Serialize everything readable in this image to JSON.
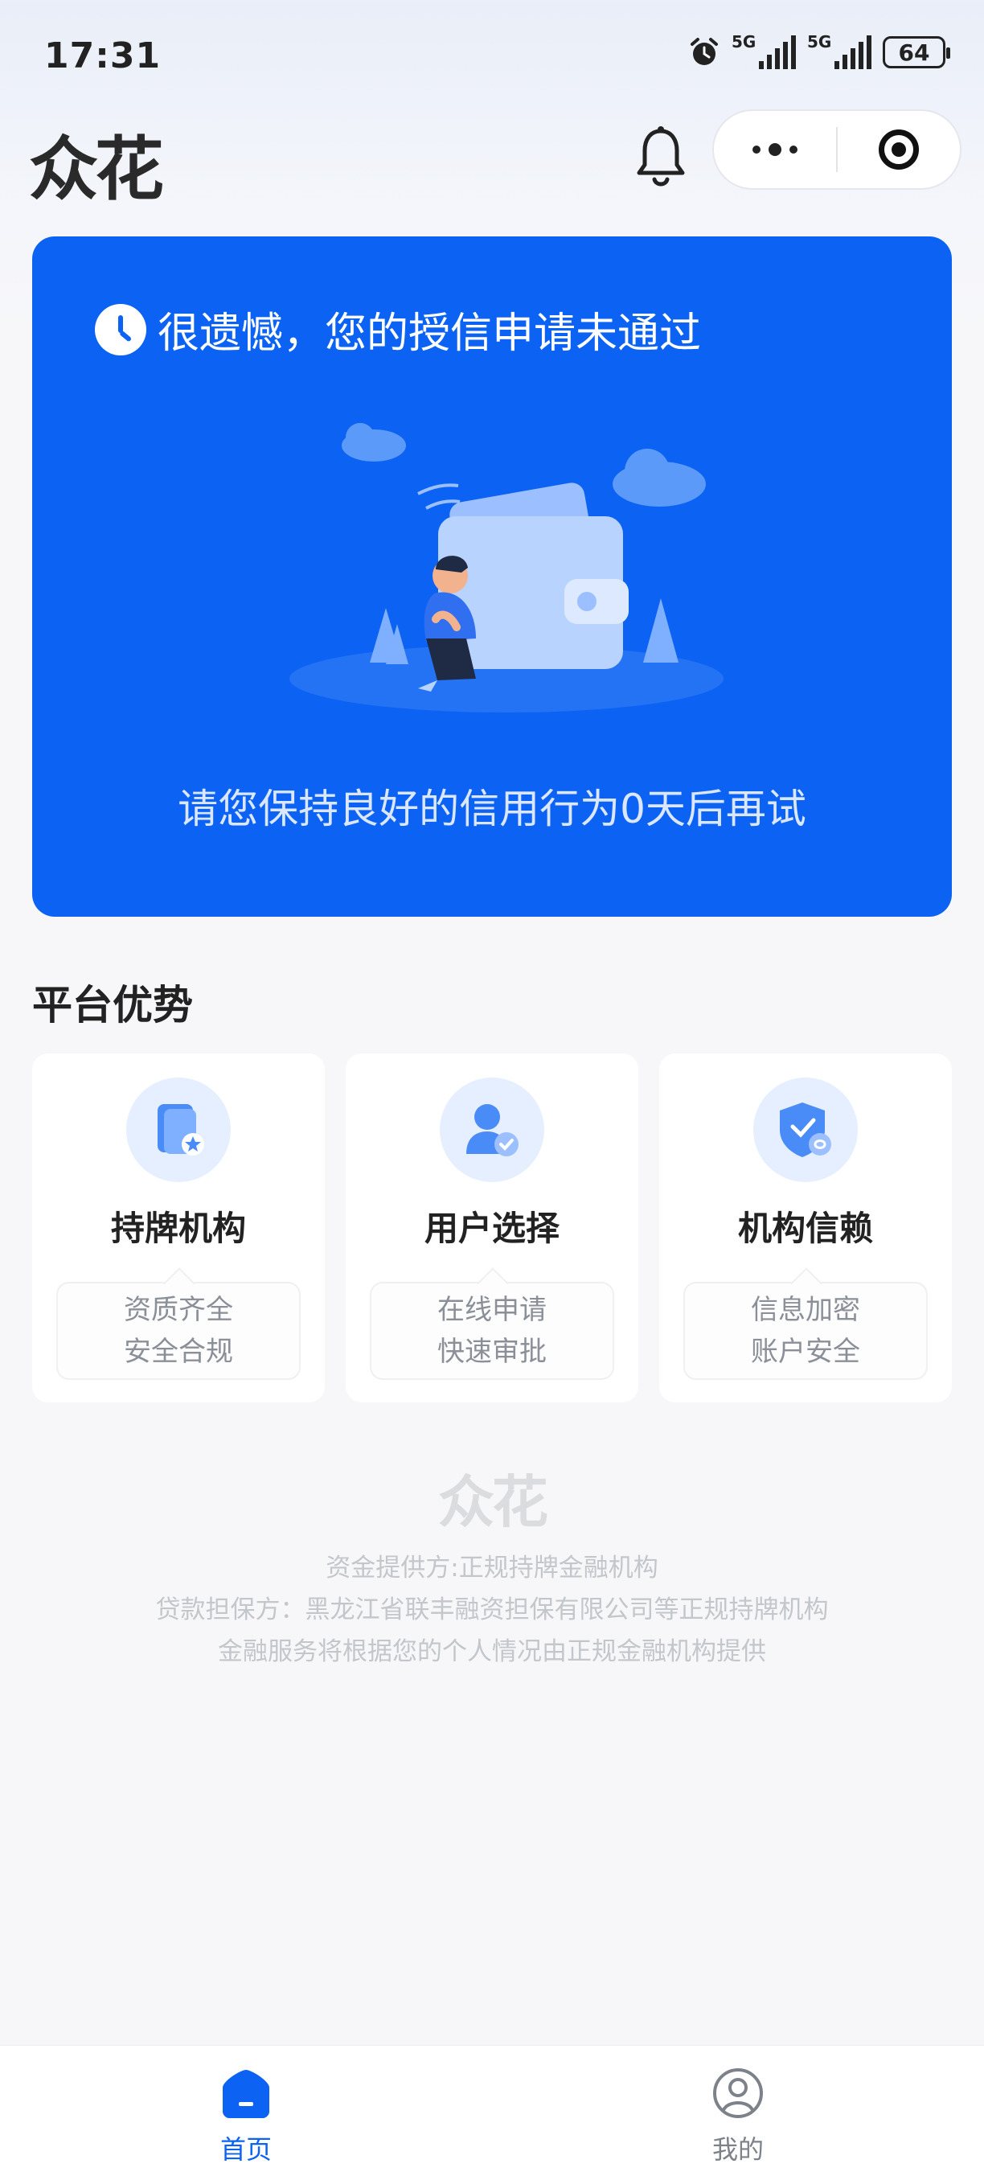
{
  "status_bar": {
    "time": "17:31",
    "network_1": "5G",
    "network_2": "5G",
    "battery": "64"
  },
  "header": {
    "logo": "众花",
    "bell_icon": "bell-icon",
    "capsule_icons": [
      "more-dots-icon",
      "close-target-icon"
    ]
  },
  "hero": {
    "title": "很遗憾，您的授信申请未通过",
    "tip": "请您保持良好的信用行为0天后再试",
    "background_color": "#0c63f3"
  },
  "advantages": {
    "title": "平台优势",
    "cards": [
      {
        "name": "持牌机构",
        "line1": "资质齐全",
        "line2": "安全合规",
        "icon": "licensed-institution-icon"
      },
      {
        "name": "用户选择",
        "line1": "在线申请",
        "line2": "快速审批",
        "icon": "user-choice-icon"
      },
      {
        "name": "机构信赖",
        "line1": "信息加密",
        "line2": "账户安全",
        "icon": "trust-shield-icon"
      }
    ]
  },
  "footer": {
    "logo": "众花",
    "line1": "资金提供方:正规持牌金融机构",
    "line2": "贷款担保方：黑龙江省联丰融资担保有限公司等正规持牌机构",
    "line3": "金融服务将根据您的个人情况由正规金融机构提供"
  },
  "tabbar": {
    "tabs": [
      {
        "label": "首页",
        "icon": "home-icon",
        "active": true
      },
      {
        "label": "我的",
        "icon": "profile-icon",
        "active": false
      }
    ],
    "accent": "#0c63f3"
  }
}
